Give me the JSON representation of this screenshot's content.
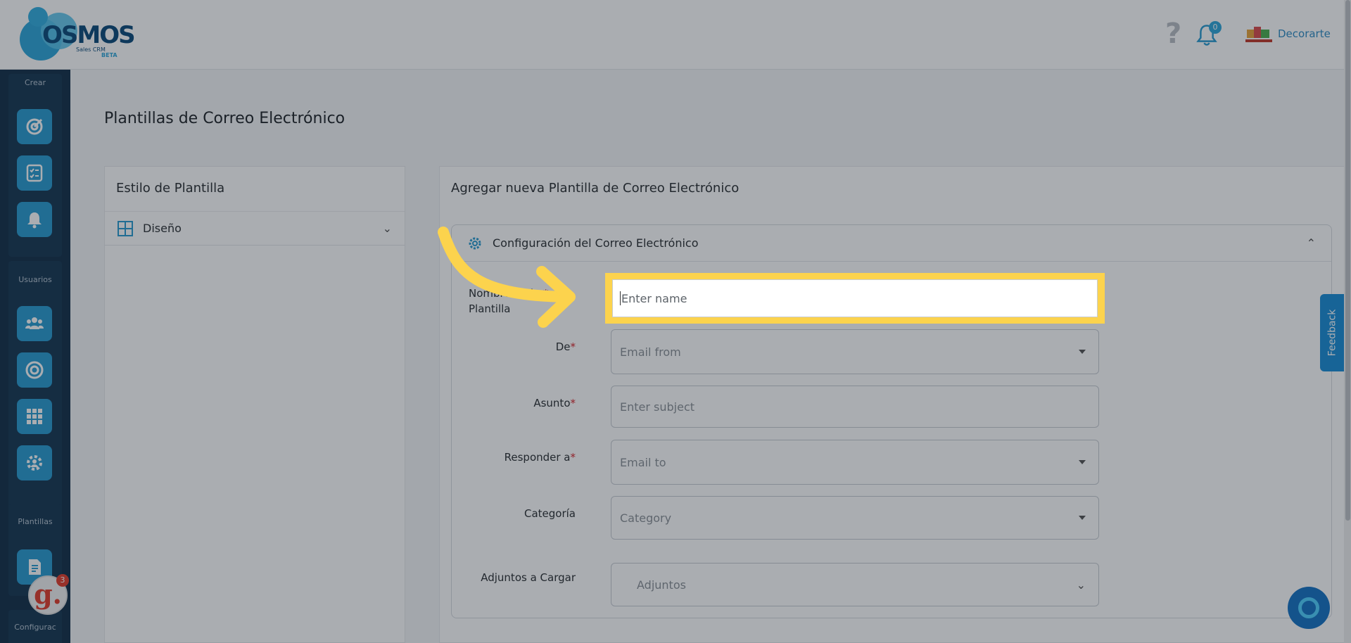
{
  "header": {
    "logo": {
      "word": "OSMOS",
      "sub": "Sales CRM",
      "beta": "BETA"
    },
    "help_icon": "question-icon",
    "notifications": {
      "icon": "bell-icon",
      "count": "0"
    },
    "company": {
      "name": "Decorarte",
      "logo_icon": "company-logo"
    }
  },
  "sidebar": {
    "sections": [
      {
        "label": "Crear",
        "items": [
          "target-icon",
          "checklist-icon",
          "alarm-icon"
        ]
      },
      {
        "label": "Usuarios",
        "items": [
          "users-icon",
          "target-ring-icon",
          "grid-icon",
          "settings-users-icon"
        ]
      },
      {
        "label": "Plantillas",
        "items": [
          "template-doc-icon"
        ]
      },
      {
        "label": "Configurac"
      }
    ],
    "g_badge": {
      "letter": "g.",
      "count": "3"
    }
  },
  "page": {
    "title": "Plantillas de Correo Electrónico"
  },
  "left_panel": {
    "title": "Estilo de Plantilla",
    "accordion_label": "Diseño"
  },
  "right_panel": {
    "title": "Agregar nueva Plantilla de Correo Electrónico",
    "section_title": "Configuración del Correo Electrónico",
    "fields": {
      "name": {
        "label_line1": "Nombre de la",
        "label_line2": "Plantilla",
        "placeholder": "Enter name"
      },
      "from": {
        "label": "De",
        "placeholder": "Email from"
      },
      "subject": {
        "label": "Asunto",
        "placeholder": "Enter subject"
      },
      "reply_to": {
        "label": "Responder a",
        "placeholder": "Email to"
      },
      "category": {
        "label": "Categoría",
        "placeholder": "Category"
      },
      "attachments": {
        "label": "Adjuntos a Cargar",
        "placeholder": "Adjuntos"
      }
    },
    "required_mark": "*"
  },
  "feedback_tab": "Feedback",
  "colors": {
    "accent": "#2a9bd1",
    "sidebar": "#133049",
    "highlight": "#fcd34d",
    "required": "#d9262c"
  }
}
